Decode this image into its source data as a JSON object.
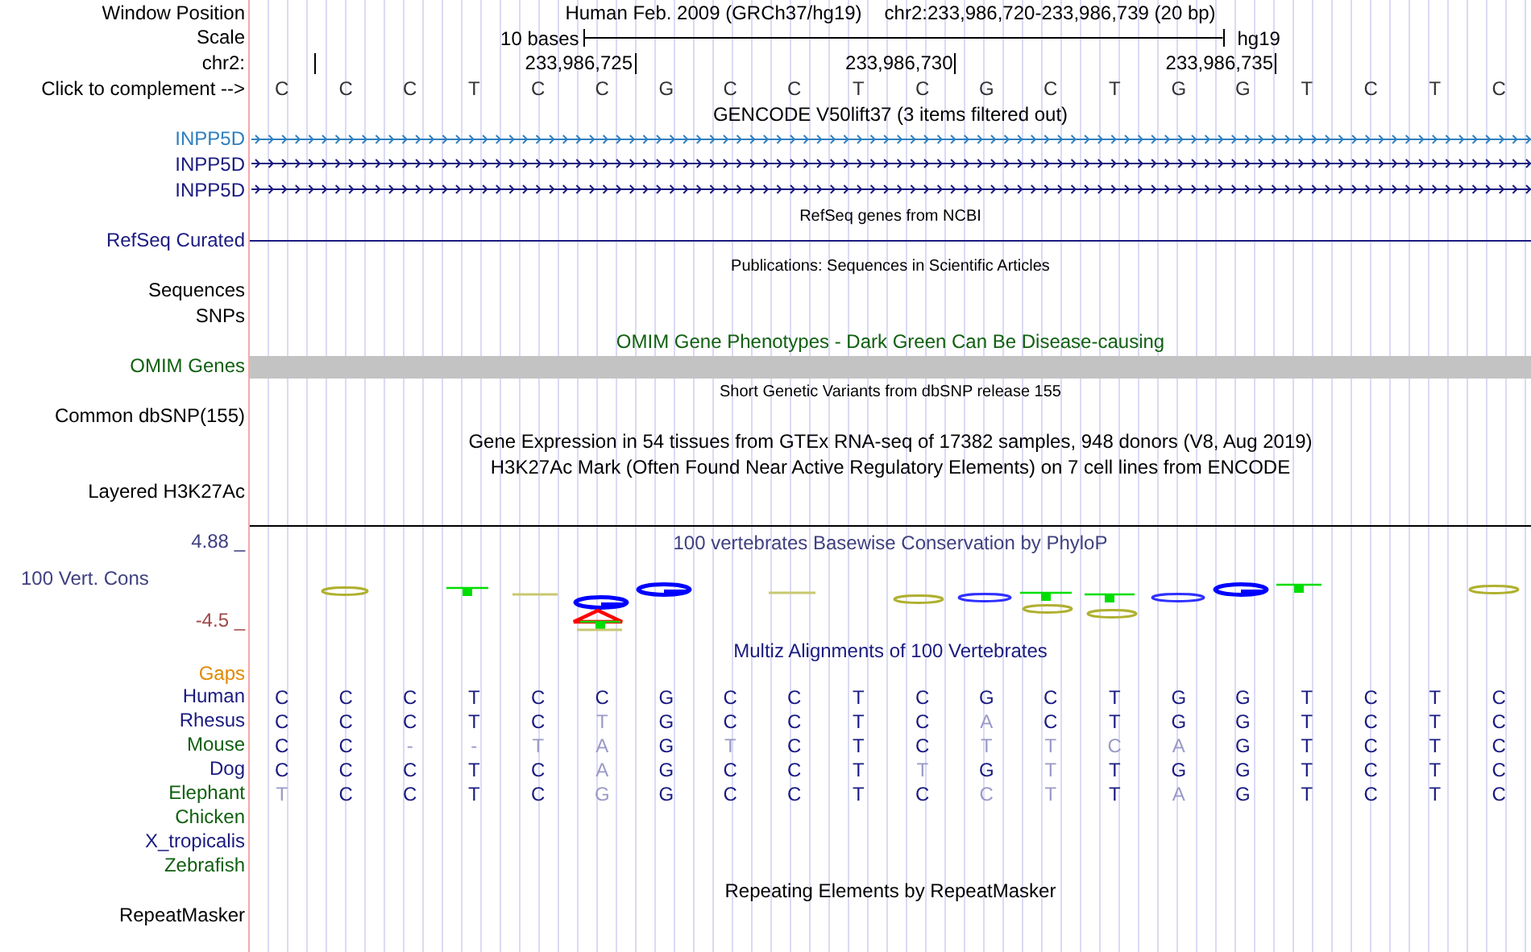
{
  "header": {
    "label": "Window Position",
    "assembly": "Human Feb. 2009 (GRCh37/hg19)",
    "position": "chr2:233,986,720-233,986,739 (20 bp)"
  },
  "scale": {
    "label": "Scale",
    "size": "10 bases",
    "assembly": "hg19"
  },
  "coordinates": {
    "label": "chr2:",
    "ticks": [
      "233,986,725",
      "233,986,730",
      "233,986,735"
    ]
  },
  "sequence": {
    "label": "Click to complement -->",
    "bases": [
      "C",
      "C",
      "C",
      "T",
      "C",
      "C",
      "G",
      "C",
      "C",
      "T",
      "C",
      "G",
      "C",
      "T",
      "G",
      "G",
      "T",
      "C",
      "T",
      "C"
    ]
  },
  "tracks": [
    {
      "kind": "genes",
      "title": "GENCODE V50lift37 (3 items filtered out)",
      "compact": false,
      "items": [
        {
          "label": "INPP5D",
          "color": "#2f7fbf"
        },
        {
          "label": "INPP5D",
          "color": "#1a1a80"
        },
        {
          "label": "INPP5D",
          "color": "#1a1a80"
        }
      ]
    },
    {
      "kind": "line",
      "title": "RefSeq genes from NCBI",
      "compact": true,
      "labels": [
        "RefSeq Curated"
      ]
    },
    {
      "kind": "empty",
      "title": "Publications: Sequences in Scientific Articles",
      "compact": true,
      "labels": [
        "Sequences",
        "SNPs"
      ]
    },
    {
      "kind": "bar",
      "title": "OMIM Gene Phenotypes - Dark Green Can Be Disease-causing",
      "compact": false,
      "labels": [
        "OMIM Genes"
      ]
    },
    {
      "kind": "empty",
      "title": "Short Genetic Variants from dbSNP release 155",
      "compact": true,
      "labels": [
        "Common dbSNP(155)"
      ]
    },
    {
      "kind": "empty",
      "title": "Gene Expression in 54 tissues from GTEx RNA-seq of 17382 samples, 948 donors (V8, Aug 2019)",
      "compact": false
    },
    {
      "kind": "signal",
      "title": "H3K27Ac Mark (Often Found Near Active Regulatory Elements) on 7 cell lines from ENCODE",
      "compact": false,
      "labels": [
        "Layered H3K27Ac"
      ]
    },
    {
      "kind": "wiggle",
      "title": "100 vertebrates Basewise Conservation by PhyloP",
      "compact": false,
      "labels": [
        "100 Vert. Cons"
      ],
      "max": "4.88 _",
      "min": "-4.5 _"
    },
    {
      "kind": "alignment",
      "title": "Multiz Alignments of 100 Vertebrates",
      "compact": false,
      "gaps_label": "Gaps",
      "species": [
        {
          "name": "Human",
          "color": "#1a1a80",
          "bases": [
            {
              "base": "C",
              "differs": false
            },
            {
              "base": "C",
              "differs": false
            },
            {
              "base": "C",
              "differs": false
            },
            {
              "base": "T",
              "differs": false
            },
            {
              "base": "C",
              "differs": false
            },
            {
              "base": "C",
              "differs": false
            },
            {
              "base": "G",
              "differs": false
            },
            {
              "base": "C",
              "differs": false
            },
            {
              "base": "C",
              "differs": false
            },
            {
              "base": "T",
              "differs": false
            },
            {
              "base": "C",
              "differs": false
            },
            {
              "base": "G",
              "differs": false
            },
            {
              "base": "C",
              "differs": false
            },
            {
              "base": "T",
              "differs": false
            },
            {
              "base": "G",
              "differs": false
            },
            {
              "base": "G",
              "differs": false
            },
            {
              "base": "T",
              "differs": false
            },
            {
              "base": "C",
              "differs": false
            },
            {
              "base": "T",
              "differs": false
            },
            {
              "base": "C",
              "differs": false
            }
          ]
        },
        {
          "name": "Rhesus",
          "color": "#1a1a80",
          "bases": [
            {
              "base": "C",
              "differs": false
            },
            {
              "base": "C",
              "differs": false
            },
            {
              "base": "C",
              "differs": false
            },
            {
              "base": "T",
              "differs": false
            },
            {
              "base": "C",
              "differs": false
            },
            {
              "base": "T",
              "differs": true
            },
            {
              "base": "G",
              "differs": false
            },
            {
              "base": "C",
              "differs": false
            },
            {
              "base": "C",
              "differs": false
            },
            {
              "base": "T",
              "differs": false
            },
            {
              "base": "C",
              "differs": false
            },
            {
              "base": "A",
              "differs": true
            },
            {
              "base": "C",
              "differs": false
            },
            {
              "base": "T",
              "differs": false
            },
            {
              "base": "G",
              "differs": false
            },
            {
              "base": "G",
              "differs": false
            },
            {
              "base": "T",
              "differs": false
            },
            {
              "base": "C",
              "differs": false
            },
            {
              "base": "T",
              "differs": false
            },
            {
              "base": "C",
              "differs": false
            }
          ]
        },
        {
          "name": "Mouse",
          "color": "#106010",
          "bases": [
            {
              "base": "C",
              "differs": false
            },
            {
              "base": "C",
              "differs": false
            },
            {
              "base": "-",
              "differs": true
            },
            {
              "base": "-",
              "differs": true
            },
            {
              "base": "T",
              "differs": true
            },
            {
              "base": "A",
              "differs": true
            },
            {
              "base": "G",
              "differs": false
            },
            {
              "base": "T",
              "differs": true
            },
            {
              "base": "C",
              "differs": false
            },
            {
              "base": "T",
              "differs": false
            },
            {
              "base": "C",
              "differs": false
            },
            {
              "base": "T",
              "differs": true
            },
            {
              "base": "T",
              "differs": true
            },
            {
              "base": "C",
              "differs": true
            },
            {
              "base": "A",
              "differs": true
            },
            {
              "base": "G",
              "differs": false
            },
            {
              "base": "T",
              "differs": false
            },
            {
              "base": "C",
              "differs": false
            },
            {
              "base": "T",
              "differs": false
            },
            {
              "base": "C",
              "differs": false
            }
          ]
        },
        {
          "name": "Dog",
          "color": "#1a1a80",
          "bases": [
            {
              "base": "C",
              "differs": false
            },
            {
              "base": "C",
              "differs": false
            },
            {
              "base": "C",
              "differs": false
            },
            {
              "base": "T",
              "differs": false
            },
            {
              "base": "C",
              "differs": false
            },
            {
              "base": "A",
              "differs": true
            },
            {
              "base": "G",
              "differs": false
            },
            {
              "base": "C",
              "differs": false
            },
            {
              "base": "C",
              "differs": false
            },
            {
              "base": "T",
              "differs": false
            },
            {
              "base": "T",
              "differs": true
            },
            {
              "base": "G",
              "differs": false
            },
            {
              "base": "T",
              "differs": true
            },
            {
              "base": "T",
              "differs": false
            },
            {
              "base": "G",
              "differs": false
            },
            {
              "base": "G",
              "differs": false
            },
            {
              "base": "T",
              "differs": false
            },
            {
              "base": "C",
              "differs": false
            },
            {
              "base": "T",
              "differs": false
            },
            {
              "base": "C",
              "differs": false
            }
          ]
        },
        {
          "name": "Elephant",
          "color": "#106010",
          "bases": [
            {
              "base": "T",
              "differs": true
            },
            {
              "base": "C",
              "differs": false
            },
            {
              "base": "C",
              "differs": false
            },
            {
              "base": "T",
              "differs": false
            },
            {
              "base": "C",
              "differs": false
            },
            {
              "base": "G",
              "differs": true
            },
            {
              "base": "G",
              "differs": false
            },
            {
              "base": "C",
              "differs": false
            },
            {
              "base": "C",
              "differs": false
            },
            {
              "base": "T",
              "differs": false
            },
            {
              "base": "C",
              "differs": false
            },
            {
              "base": "C",
              "differs": true
            },
            {
              "base": "T",
              "differs": true
            },
            {
              "base": "T",
              "differs": false
            },
            {
              "base": "A",
              "differs": true
            },
            {
              "base": "G",
              "differs": false
            },
            {
              "base": "T",
              "differs": false
            },
            {
              "base": "C",
              "differs": false
            },
            {
              "base": "T",
              "differs": false
            },
            {
              "base": "C",
              "differs": false
            }
          ]
        },
        {
          "name": "Chicken",
          "color": "#106010"
        },
        {
          "name": "X_tropicalis",
          "color": "#1a1a80"
        },
        {
          "name": "Zebrafish",
          "color": "#106010"
        }
      ]
    },
    {
      "kind": "empty",
      "title": "Repeating Elements by RepeatMasker",
      "compact": false,
      "labels": [
        "RepeatMasker"
      ]
    }
  ]
}
